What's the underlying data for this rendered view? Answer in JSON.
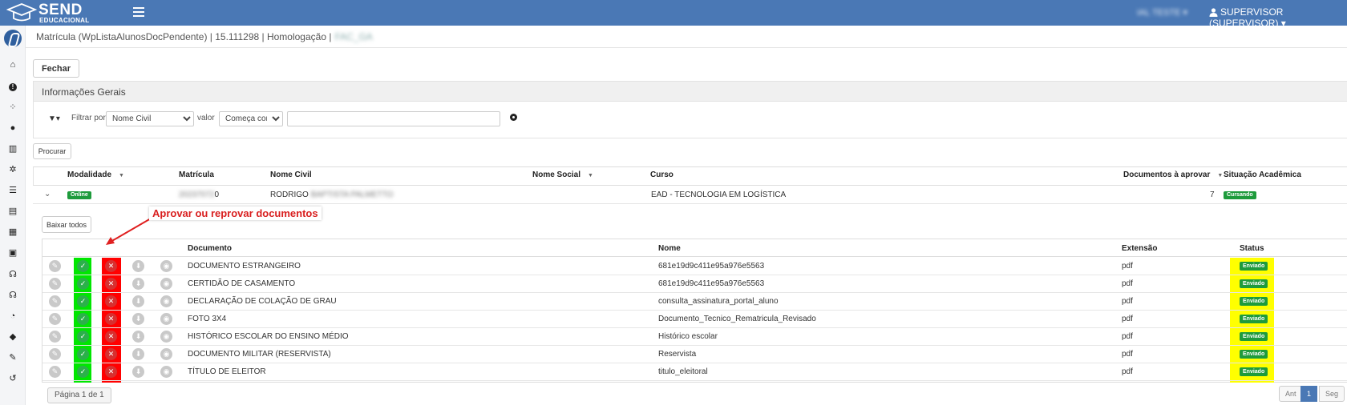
{
  "app": {
    "brand": "SEND",
    "brand_sub": "EDUCACIONAL",
    "user_blurred": "IAL TESTE",
    "user": "SUPERVISOR (SUPERVISOR)",
    "accent": "#4a78b5"
  },
  "sidebar": {
    "icons": [
      "logo-icon",
      "home-icon",
      "alert-icon",
      "spinner-icon",
      "user-icon",
      "bar-chart-icon",
      "cogs-icon",
      "list-icon",
      "id-card-icon",
      "calendar-check-icon",
      "inbox-icon",
      "headset-icon",
      "headset-icon",
      "chat-icon",
      "graduation-cap-icon",
      "wrench-icon",
      "history-icon"
    ]
  },
  "breadcrumb": {
    "text": "Matrícula (WpListaAlunosDocPendente) | 15.111298 | Homologação |",
    "blurred": "FAC_GA"
  },
  "actions": {
    "close": "Fechar",
    "search": "Procurar",
    "download_all": "Baixar todos"
  },
  "panel": {
    "title": "Informações Gerais"
  },
  "filter": {
    "filter_by_label": "Filtrar por",
    "field_value": "Nome Civil",
    "value_label": "valor",
    "operator_value": "Começa com",
    "text_value": ""
  },
  "main_table": {
    "headers": {
      "modalidade": "Modalidade",
      "matricula": "Matrícula",
      "nome_civil": "Nome Civil",
      "nome_social": "Nome Social",
      "curso": "Curso",
      "docs": "Documentos à aprovar",
      "situacao": "Situação Acadêmica"
    },
    "row": {
      "modalidade": "Online",
      "matricula_blurred": "20237072",
      "matricula_tail": "0",
      "nome_first": "RODRIGO",
      "nome_blurred": "BAPTISTA PALMETTO",
      "curso": "EAD - TECNOLOGIA EM LOGÍSTICA",
      "docs": "7",
      "situacao": "Cursando"
    }
  },
  "annotation": "Aprovar ou reprovar documentos",
  "docs_table": {
    "headers": {
      "documento": "Documento",
      "nome": "Nome",
      "extensao": "Extensão",
      "status": "Status"
    },
    "rows": [
      {
        "documento": "DOCUMENTO ESTRANGEIRO",
        "nome": "681e19d9c411e95a976e5563",
        "extensao": "pdf",
        "status": "Enviado"
      },
      {
        "documento": "CERTIDÃO DE CASAMENTO",
        "nome": "681e19d9c411e95a976e5563",
        "extensao": "pdf",
        "status": "Enviado"
      },
      {
        "documento": "DECLARAÇÃO DE COLAÇÃO DE GRAU",
        "nome": "consulta_assinatura_portal_aluno",
        "extensao": "pdf",
        "status": "Enviado"
      },
      {
        "documento": "FOTO 3X4",
        "nome": "Documento_Tecnico_Rematricula_Revisado",
        "extensao": "pdf",
        "status": "Enviado"
      },
      {
        "documento": "HISTÓRICO ESCOLAR DO ENSINO MÉDIO",
        "nome": "Histórico escolar",
        "extensao": "pdf",
        "status": "Enviado"
      },
      {
        "documento": "DOCUMENTO MILITAR (RESERVISTA)",
        "nome": "Reservista",
        "extensao": "pdf",
        "status": "Enviado"
      },
      {
        "documento": "TÍTULO DE ELEITOR",
        "nome": "titulo_eleitoral",
        "extensao": "pdf",
        "status": "Enviado"
      }
    ]
  },
  "pagination": {
    "info": "Página 1 de 1",
    "prev": "Ant",
    "current": "1",
    "next": "Seg"
  }
}
